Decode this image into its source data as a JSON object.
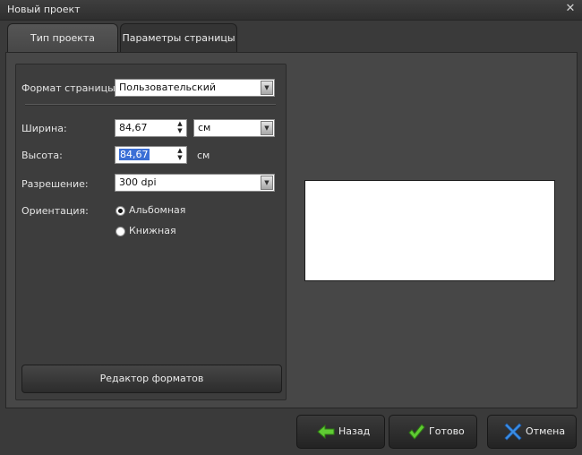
{
  "window": {
    "title": "Новый проект",
    "close_icon": "✕"
  },
  "tabs": [
    {
      "label": "Тип проекта",
      "active": false
    },
    {
      "label": "Параметры страницы",
      "active": true
    }
  ],
  "form": {
    "page_format": {
      "label": "Формат страницы:",
      "value": "Пользовательский"
    },
    "width": {
      "label": "Ширина:",
      "value": "84,67",
      "unit": "см"
    },
    "height": {
      "label": "Высота:",
      "value": "84,67",
      "unit": "см"
    },
    "resolution": {
      "label": "Разрешение:",
      "value": "300 dpi"
    },
    "orientation": {
      "label": "Ориентация:",
      "options": [
        {
          "label": "Альбомная",
          "checked": true
        },
        {
          "label": "Книжная",
          "checked": false
        }
      ]
    },
    "formats_editor_label": "Редактор форматов"
  },
  "buttons": {
    "back": "Назад",
    "done": "Готово",
    "cancel": "Отмена"
  },
  "colors": {
    "background": "#3a3a3a",
    "panel": "#474747",
    "back_arrow": "#5fcc33",
    "done_check": "#5fcc33",
    "cancel_x": "#3b8fe6"
  }
}
